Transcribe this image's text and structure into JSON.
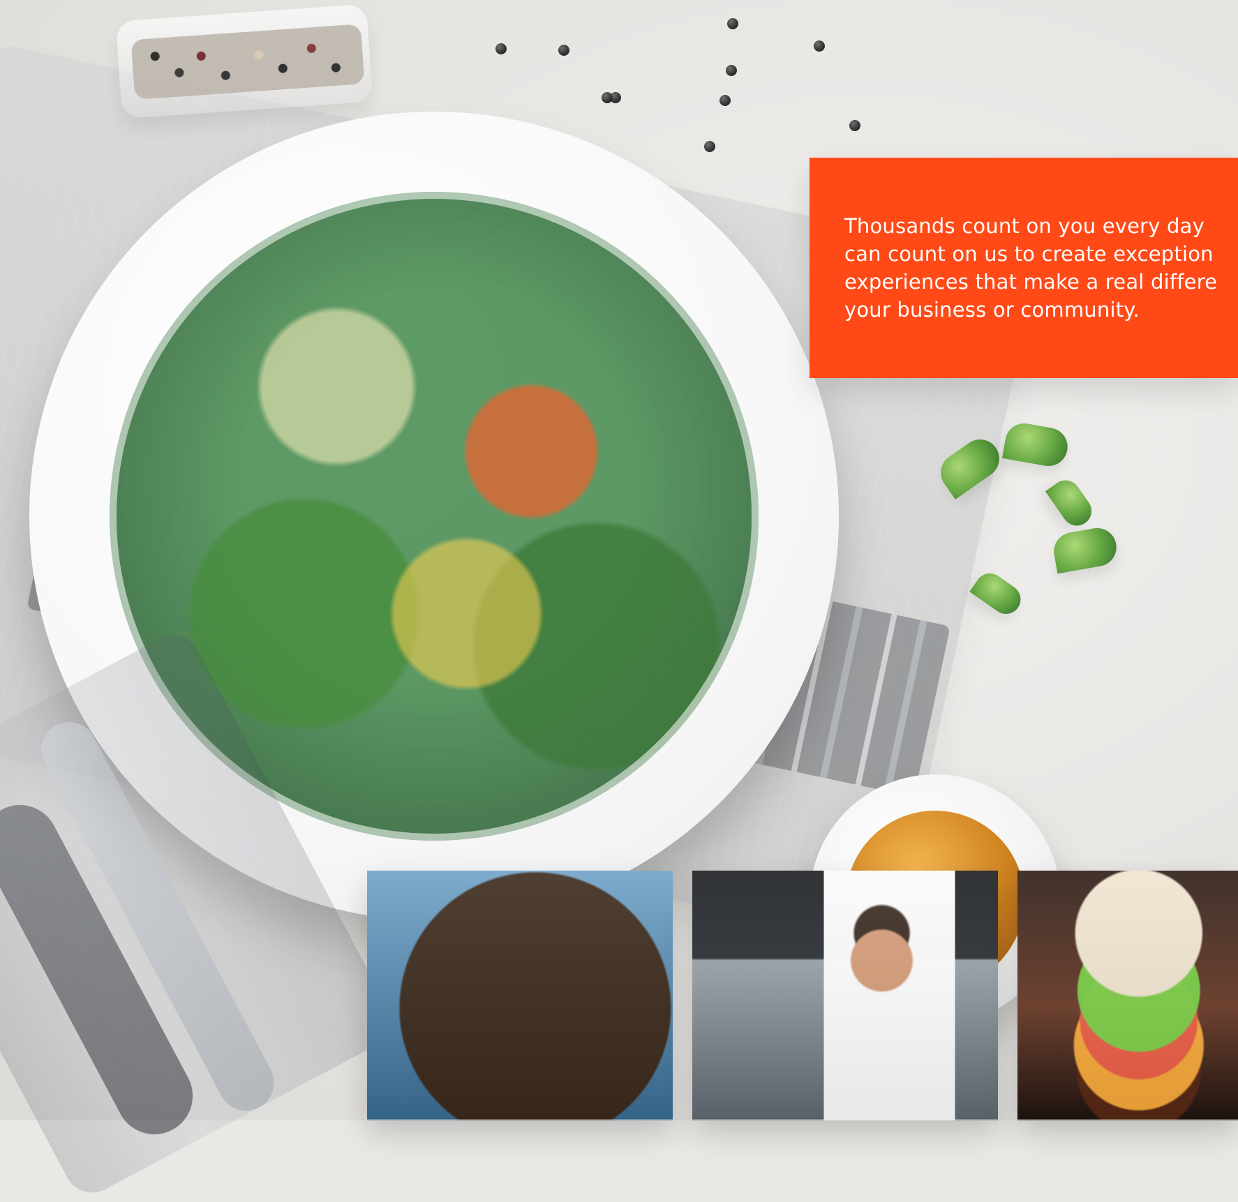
{
  "callout": {
    "line1": "Thousands count on you every day",
    "line2": "can count on us to create exception",
    "line3": "experiences that make a real differe",
    "line4": "your business or community.",
    "background_color": "#ff4a17",
    "text_color": "#ffffff"
  },
  "thumbnails": [
    {
      "subject": "smoothie-bowl"
    },
    {
      "subject": "chef"
    },
    {
      "subject": "burger"
    }
  ]
}
